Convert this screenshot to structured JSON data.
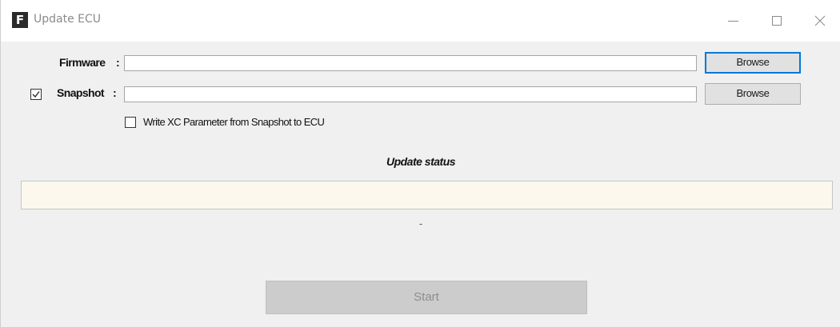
{
  "window": {
    "title": "Update ECU",
    "app_icon_letter": "F",
    "controls": {
      "minimize_icon": "minimize-icon",
      "maximize_icon": "maximize-icon",
      "close_icon": "close-icon"
    }
  },
  "form": {
    "firmware": {
      "label": "Firmware",
      "colon": ":",
      "value": "",
      "browse_label": "Browse"
    },
    "snapshot": {
      "label": "Snapshot",
      "colon": ":",
      "enabled": true,
      "value": "",
      "browse_label": "Browse"
    },
    "write_xc": {
      "label": "Write XC Parameter from Snapshot to ECU",
      "checked": false
    }
  },
  "status": {
    "heading": "Update status",
    "message": "",
    "detail": "-"
  },
  "actions": {
    "start_label": "Start",
    "start_enabled": false
  },
  "colors": {
    "focus_border": "#0078d7",
    "status_background": "#fdf8ee",
    "window_background": "#f0f0f0"
  }
}
